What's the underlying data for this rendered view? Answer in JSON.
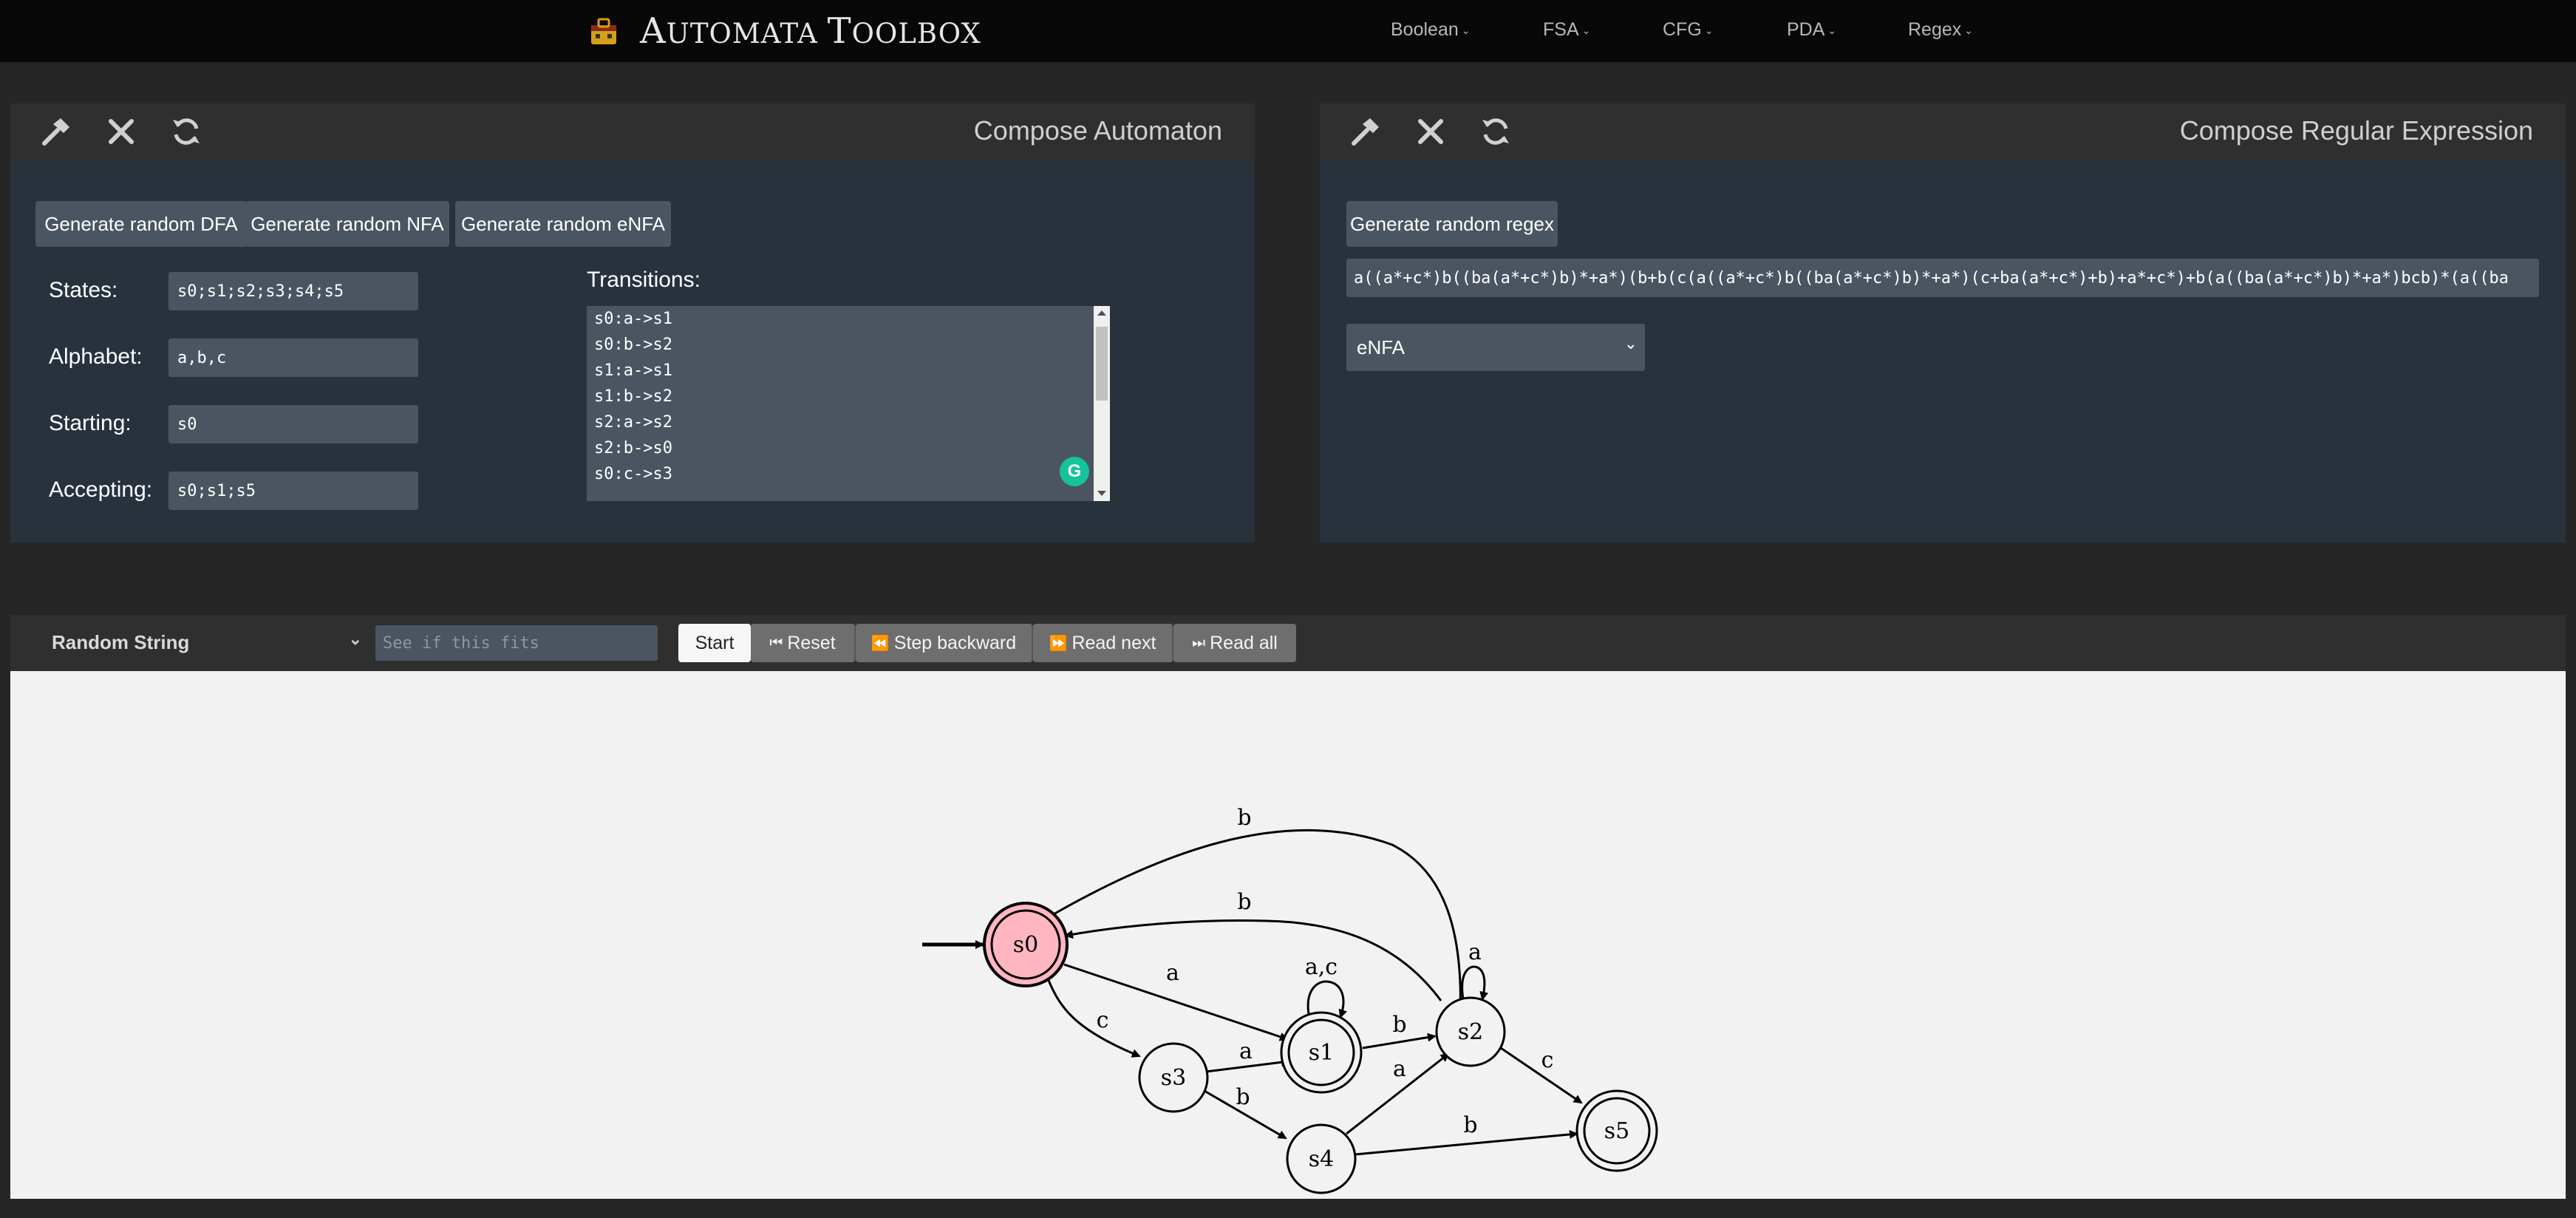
{
  "navbar": {
    "brand": "AUTOMATA TOOLBOX",
    "brand_parts": {
      "a": "A",
      "rest1": "UTOMATA ",
      "t": "T",
      "rest2": "OOLBOX"
    },
    "items": [
      "Boolean",
      "FSA",
      "CFG",
      "PDA",
      "Regex"
    ]
  },
  "automaton_panel": {
    "title": "Compose Automaton",
    "buttons": [
      "Generate random DFA",
      "Generate random NFA",
      "Generate random eNFA"
    ],
    "labels": {
      "states": "States:",
      "alphabet": "Alphabet:",
      "starting": "Starting:",
      "accepting": "Accepting:",
      "transitions": "Transitions:"
    },
    "values": {
      "states": "s0;s1;s2;s3;s4;s5",
      "alphabet": "a,b,c",
      "starting": "s0",
      "accepting": "s0;s1;s5"
    },
    "transitions": [
      "s0:a->s1",
      "s0:b->s2",
      "s1:a->s1",
      "s1:b->s2",
      "s2:a->s2",
      "s2:b->s0",
      "s0:c->s3"
    ]
  },
  "regex_panel": {
    "title": "Compose Regular Expression",
    "button": "Generate random regex",
    "regex": "a((a*+c*)b((ba(a*+c*)b)*+a*)(b+b(c(a((a*+c*)b((ba(a*+c*)b)*+a*)(c+ba(a*+c*)+b)+a*+c*)+b(a((ba(a*+c*)b)*+a*)bcb)*(a((ba",
    "type": "eNFA"
  },
  "runbar": {
    "mode": "Random String",
    "input_placeholder": "See if this fits",
    "buttons": {
      "start": "Start",
      "reset": "Reset",
      "step_backward": "Step backward",
      "read_next": "Read next",
      "read_all": "Read all"
    }
  },
  "graph": {
    "states": [
      {
        "id": "s0",
        "label": "s0",
        "accepting": true,
        "start": true,
        "active": true
      },
      {
        "id": "s1",
        "label": "s1",
        "accepting": true
      },
      {
        "id": "s2",
        "label": "s2",
        "accepting": false
      },
      {
        "id": "s3",
        "label": "s3",
        "accepting": false
      },
      {
        "id": "s4",
        "label": "s4",
        "accepting": false
      },
      {
        "id": "s5",
        "label": "s5",
        "accepting": true
      }
    ],
    "edge_labels": {
      "s0_s2": "b",
      "s2_s0": "b",
      "s0_s1": "a",
      "s1_loop": "a,c",
      "s0_s3": "c",
      "s3_s1": "a",
      "s1_s2": "b",
      "s2_loop": "a",
      "s3_s4": "b",
      "s4_s2": "a",
      "s2_s5": "c",
      "s4_s5": "b"
    },
    "colors": {
      "active_state": "#ffb6c1"
    }
  }
}
